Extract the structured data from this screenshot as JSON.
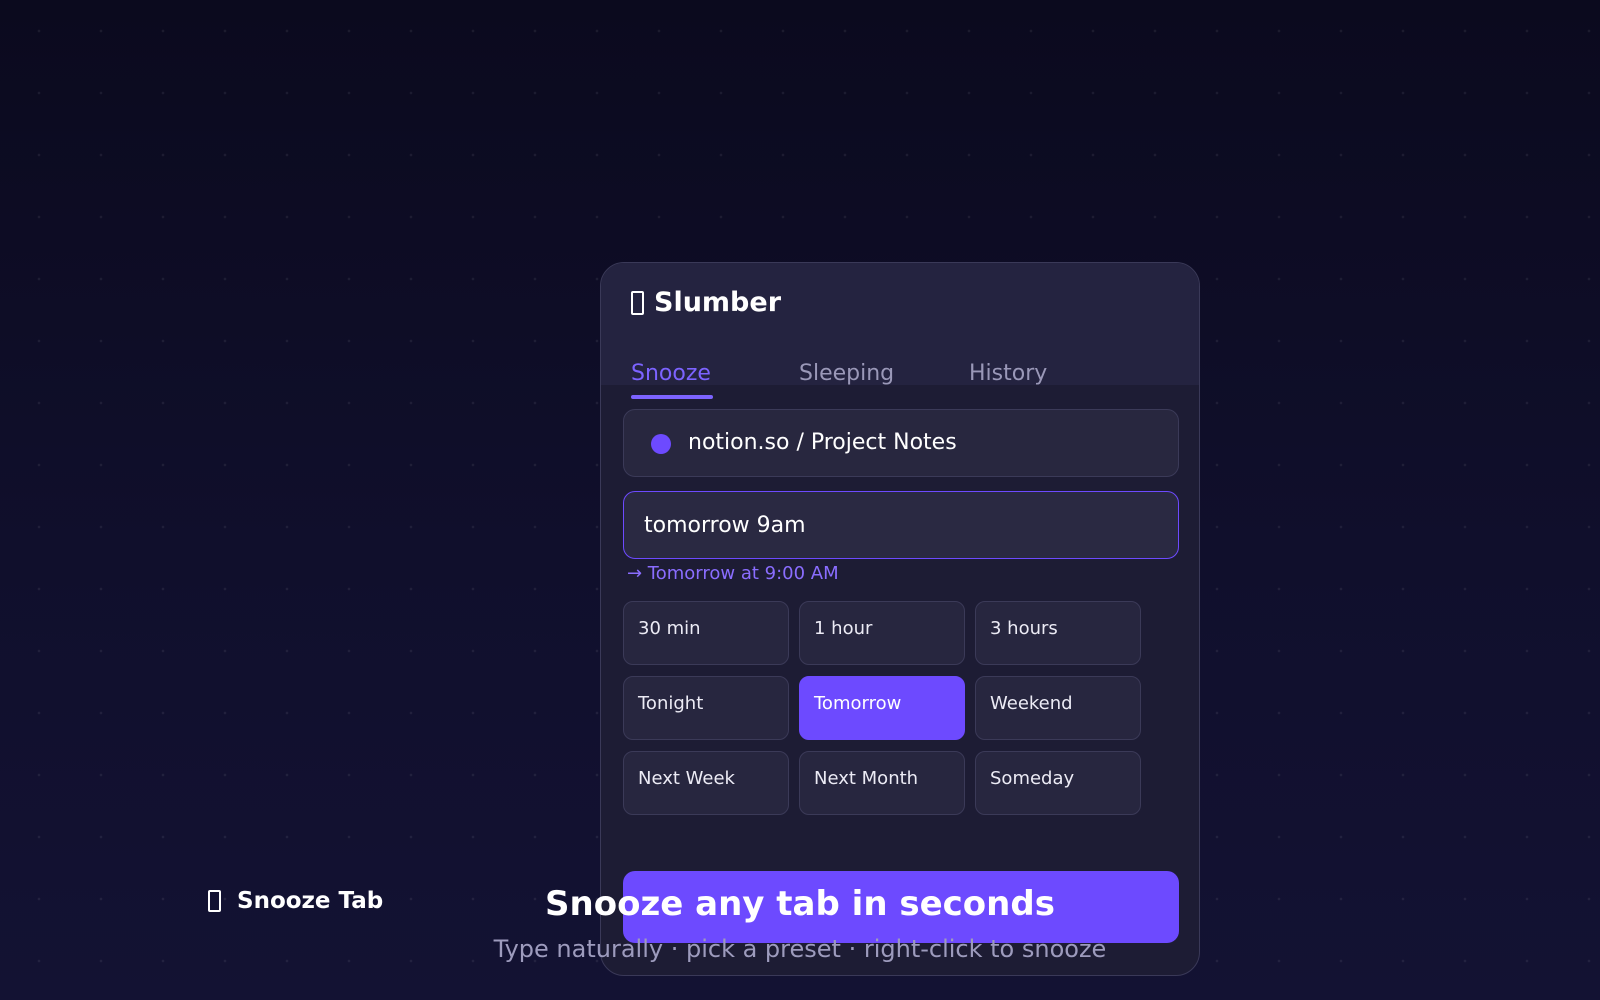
{
  "popup": {
    "app_name": "Slumber",
    "app_icon": "moon-icon",
    "tabs": [
      {
        "label": "Snooze",
        "active": true
      },
      {
        "label": "Sleeping",
        "active": false
      },
      {
        "label": "History",
        "active": false
      }
    ],
    "current_tab": {
      "title": "notion.so / Project Notes",
      "favicon_color": "#6d4aff"
    },
    "time_input": {
      "value": "tomorrow 9am"
    },
    "parsed_preview": "→ Tomorrow at 9:00 AM",
    "presets": [
      {
        "label": "30 min",
        "selected": false
      },
      {
        "label": "1 hour",
        "selected": false
      },
      {
        "label": "3 hours",
        "selected": false
      },
      {
        "label": "Tonight",
        "selected": false
      },
      {
        "label": "Tomorrow",
        "selected": true
      },
      {
        "label": "Weekend",
        "selected": false
      },
      {
        "label": "Next Week",
        "selected": false
      },
      {
        "label": "Next Month",
        "selected": false
      },
      {
        "label": "Someday",
        "selected": false
      }
    ]
  },
  "feature_label": {
    "icon": "moon-icon",
    "text": "Snooze Tab"
  },
  "headline": "Snooze any tab in seconds",
  "subheadline": "Type naturally · pick a preset · right-click to snooze",
  "colors": {
    "accent": "#6d4aff",
    "accent_text": "#7c63ff",
    "background": "#0d0c22",
    "card": "#1d1c34"
  }
}
